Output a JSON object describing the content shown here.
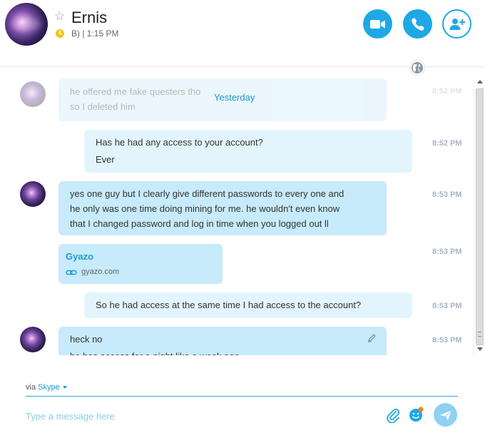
{
  "contact": {
    "name": "Ernis",
    "status": "B) | 1:15 PM"
  },
  "header_icons": {
    "star": "star-icon",
    "video": "video-camera-icon",
    "call": "phone-icon",
    "add": "add-person-icon",
    "globe": "globe-icon"
  },
  "colors": {
    "accent": "#1ea8e6",
    "incoming_bubble": "#c7ebfb",
    "outgoing_bubble": "#e2f5fd",
    "status": "#f7c21b"
  },
  "separator": "Yesterday",
  "faded": {
    "line1": "he offered me fake questers tho",
    "line2": "so I deleted him",
    "time": "8:52 PM"
  },
  "messages": [
    {
      "lines": [
        "Has he had any access to your account?",
        "Ever"
      ],
      "time": "8:52 PM"
    },
    {
      "lines": [
        "yes one guy but I clearly give different passwords to every one and",
        "he only was one time doing mining for me. he wouldn't even know",
        "that I changed password and log in time when you logged out ll"
      ],
      "time": "8:53 PM"
    },
    {
      "link_title": "Gyazo",
      "link_url": "gyazo.com",
      "time": "8:53 PM"
    },
    {
      "lines": [
        "So he had access at the same time I had access to the account?"
      ],
      "time": "8:53 PM"
    },
    {
      "lines": [
        "heck no",
        "he has access for a night like a week ago"
      ],
      "time": "8:53 PM"
    }
  ],
  "composer": {
    "via_label": "via",
    "via_service": "Skype",
    "placeholder": "Type a message here"
  }
}
